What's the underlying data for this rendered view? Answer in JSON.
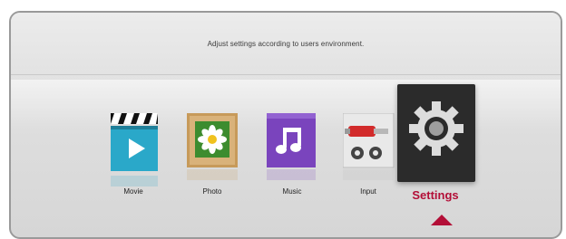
{
  "hint": "Adjust settings according to users environment.",
  "menu": {
    "items": [
      {
        "label": "Movie",
        "icon": "movie-clapper-icon"
      },
      {
        "label": "Photo",
        "icon": "photo-daisy-icon"
      },
      {
        "label": "Music",
        "icon": "music-note-icon"
      },
      {
        "label": "Input",
        "icon": "input-connector-icon"
      },
      {
        "label": "Settings",
        "icon": "gear-icon"
      }
    ],
    "selected": "Settings"
  },
  "colors": {
    "accent": "#b30e37",
    "movie": "#2aa8c9",
    "photo": "#c79a5a",
    "music": "#7a44bd",
    "settings_bg": "#2b2b2b"
  }
}
